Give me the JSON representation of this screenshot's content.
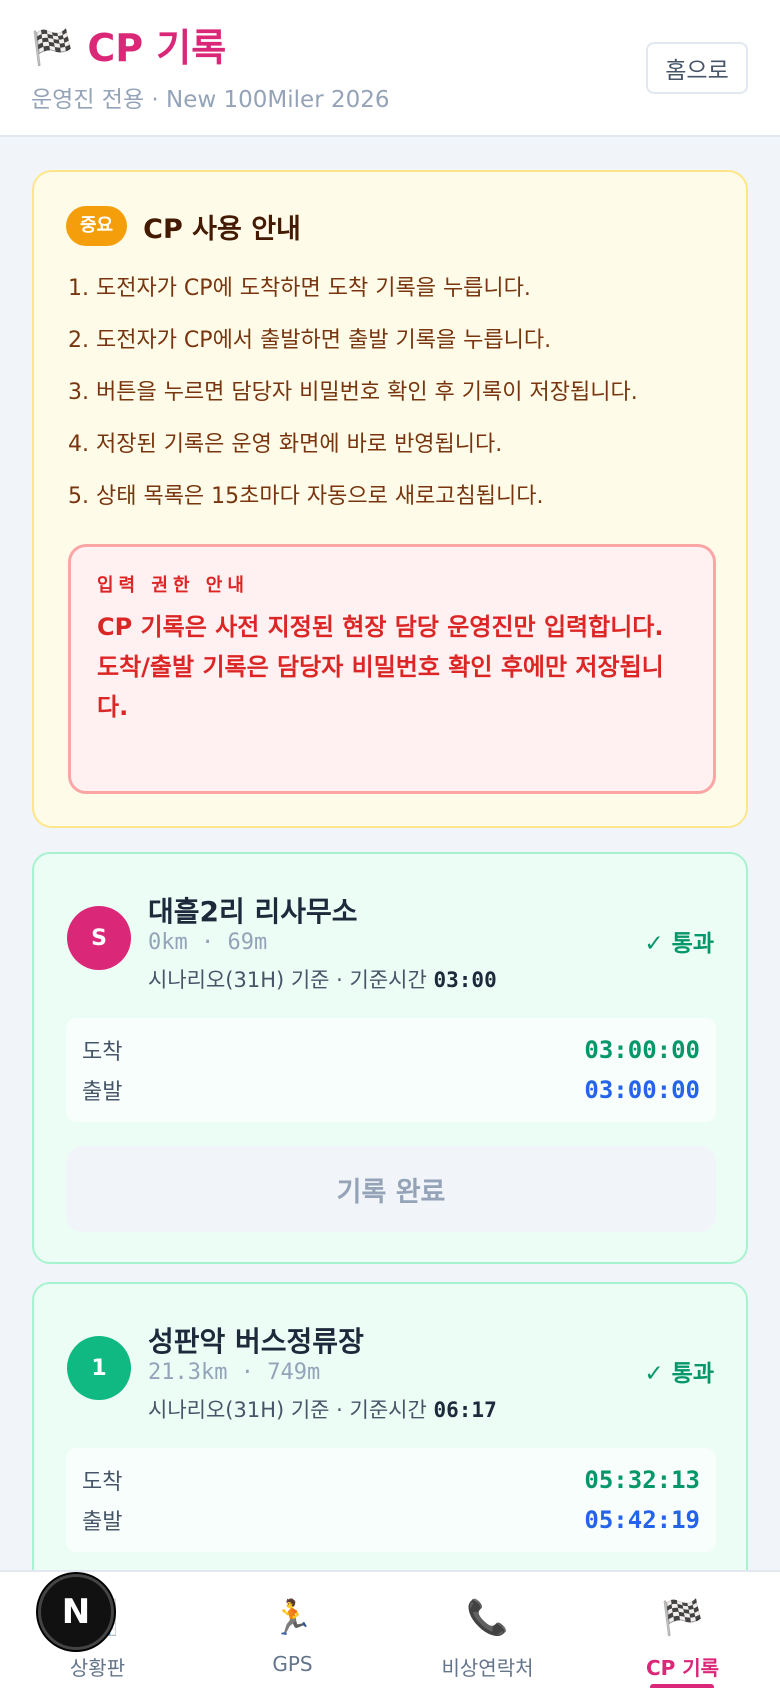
{
  "header": {
    "flag_icon": "🏁",
    "title": "CP 기록",
    "subtitle": "운영진 전용 · New 100Miler 2026",
    "home_button": "홈으로"
  },
  "notice": {
    "badge": "중요",
    "title": "CP 사용 안내",
    "items": [
      "1. 도전자가 CP에 도착하면 도착 기록을 누릅니다.",
      "2. 도전자가 CP에서 출발하면 출발 기록을 누릅니다.",
      "3. 버튼을 누르면 담당자 비밀번호 확인 후 기록이 저장됩니다.",
      "4. 저장된 기록은 운영 화면에 바로 반영됩니다.",
      "5. 상태 목록은 15초마다 자동으로 새로고침됩니다."
    ],
    "permission": {
      "label": "입력 권한 안내",
      "line1": "CP 기록은 사전 지정된 현장 담당 운영진만 입력합니다.",
      "line2": "도착/출발 기록은 담당자 비밀번호 확인 후에만 저장됩니다."
    }
  },
  "checkpoints": [
    {
      "badge": "S",
      "badge_color": "#db2777",
      "name": "대흘2리 리사무소",
      "distance": "0km · 69m",
      "scenario_prefix": "시나리오(31H) 기준 · 기준시간",
      "scenario_time": "03:00",
      "status": "✓ 통과",
      "arrival_label": "도착",
      "arrival_time": "03:00:00",
      "departure_label": "출발",
      "departure_time": "03:00:00",
      "button": "기록 완료"
    },
    {
      "badge": "1",
      "badge_color": "#10b981",
      "name": "성판악 버스정류장",
      "distance": "21.3km · 749m",
      "scenario_prefix": "시나리오(31H) 기준 · 기준시간",
      "scenario_time": "06:17",
      "status": "✓ 통과",
      "arrival_label": "도착",
      "arrival_time": "05:32:13",
      "departure_label": "출발",
      "departure_time": "05:42:19"
    }
  ],
  "tabbar": {
    "tabs": [
      {
        "icon": "📊",
        "label": "상황판"
      },
      {
        "icon": "🏃",
        "label": "GPS"
      },
      {
        "icon": "📞",
        "label": "비상연락처"
      },
      {
        "icon": "🏁",
        "label": "CP 기록"
      }
    ],
    "active_index": 3
  },
  "overlay_badge": "N"
}
